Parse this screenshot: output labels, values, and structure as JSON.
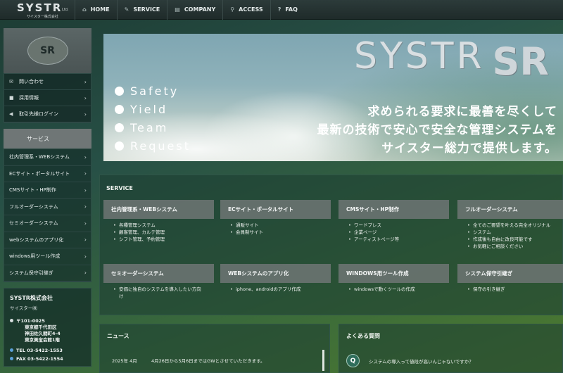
{
  "header": {
    "logo_word": "SYSTR",
    "logo_ltd": "Ltd.",
    "logo_kana": "サイスター株式会社",
    "nav": [
      {
        "label": "HOME",
        "icon": "home-icon",
        "glyph": "⌂"
      },
      {
        "label": "SERVICE",
        "icon": "pencil-icon",
        "glyph": "✎"
      },
      {
        "label": "COMPANY",
        "icon": "building-icon",
        "glyph": "▤"
      },
      {
        "label": "ACCESS",
        "icon": "map-pin-icon",
        "glyph": "⚲"
      },
      {
        "label": "FAQ",
        "icon": "question-icon",
        "glyph": "?"
      }
    ]
  },
  "sidebar": {
    "emblem_text": "SR",
    "links": [
      {
        "label": "問い合わせ",
        "glyph": "✉"
      },
      {
        "label": "採用情報",
        "glyph": "■"
      },
      {
        "label": "取引先様ログイン",
        "glyph": "◀"
      }
    ],
    "service_heading": "サービス",
    "services": [
      "社内管理系・WEBシステム",
      "ECサイト・ポータルサイト",
      "CMSサイト・HP制作",
      "フルオーダーシステム",
      "セミオーダーシステム",
      "webシステムのアプリ化",
      "windows用ツール作成",
      "システム保守引継ぎ"
    ],
    "company": {
      "name": "SYSTR株式会社",
      "kana": "サイスター㈱",
      "postal": "〒101-0025",
      "addr1": "東京都千代田区",
      "addr2": "神田佐久間町4-4",
      "addr3": "東京美宝会館1階",
      "tel": "TEL 03-5422-1553",
      "fax": "FAX 03-5422-1554"
    }
  },
  "hero": {
    "brand": "SYSTR",
    "brand_mark": "SR",
    "keywords": [
      "Safety",
      "Yield",
      "Team",
      "Request"
    ],
    "tagline": [
      "求められる要求に最善を尽くして",
      "最新の技術で安心で安全な管理システムを",
      "サイスター総力で提供します。"
    ]
  },
  "service": {
    "title": "SERVICE",
    "cards": [
      {
        "title": "社内管理系・WEBシステム",
        "items": [
          "各種管理システム",
          "顧客管理、カルテ管理",
          "シフト管理、予約管理"
        ]
      },
      {
        "title": "ECサイト・ポータルサイト",
        "items": [
          "通販サイト",
          "会員制サイト"
        ]
      },
      {
        "title": "CMSサイト・HP制作",
        "items": [
          "ワードプレス",
          "企業ページ",
          "アーティストページ等"
        ]
      },
      {
        "title": "フルオーダーシステム",
        "items": [
          "全てのご要望を叶える完全オリジナル",
          "システム",
          "作成後も自由に改良可能です",
          "お気軽にご相談ください"
        ]
      },
      {
        "title": "セミオーダーシステム",
        "items": [
          "安価に独自のシステムを導入したい方向",
          "け"
        ]
      },
      {
        "title": "WEBシステムのアプリ化",
        "items": [
          "iphone、androidのアプリ作成"
        ]
      },
      {
        "title": "WINDOWS用ツール作成",
        "items": [
          "windowsで動くツールの作成"
        ]
      },
      {
        "title": "システム保守引継ぎ",
        "items": [
          "保守の引き継ぎ"
        ]
      }
    ]
  },
  "news": {
    "title": "ニュース",
    "items": [
      {
        "date": "2025年 4月",
        "text": "4月26日から5月6日まではGWとさせていただきます。"
      }
    ]
  },
  "faq": {
    "title": "よくある質問",
    "badge": "Q",
    "items": [
      "システムの導入って値段が高いんじゃないですか？"
    ]
  }
}
